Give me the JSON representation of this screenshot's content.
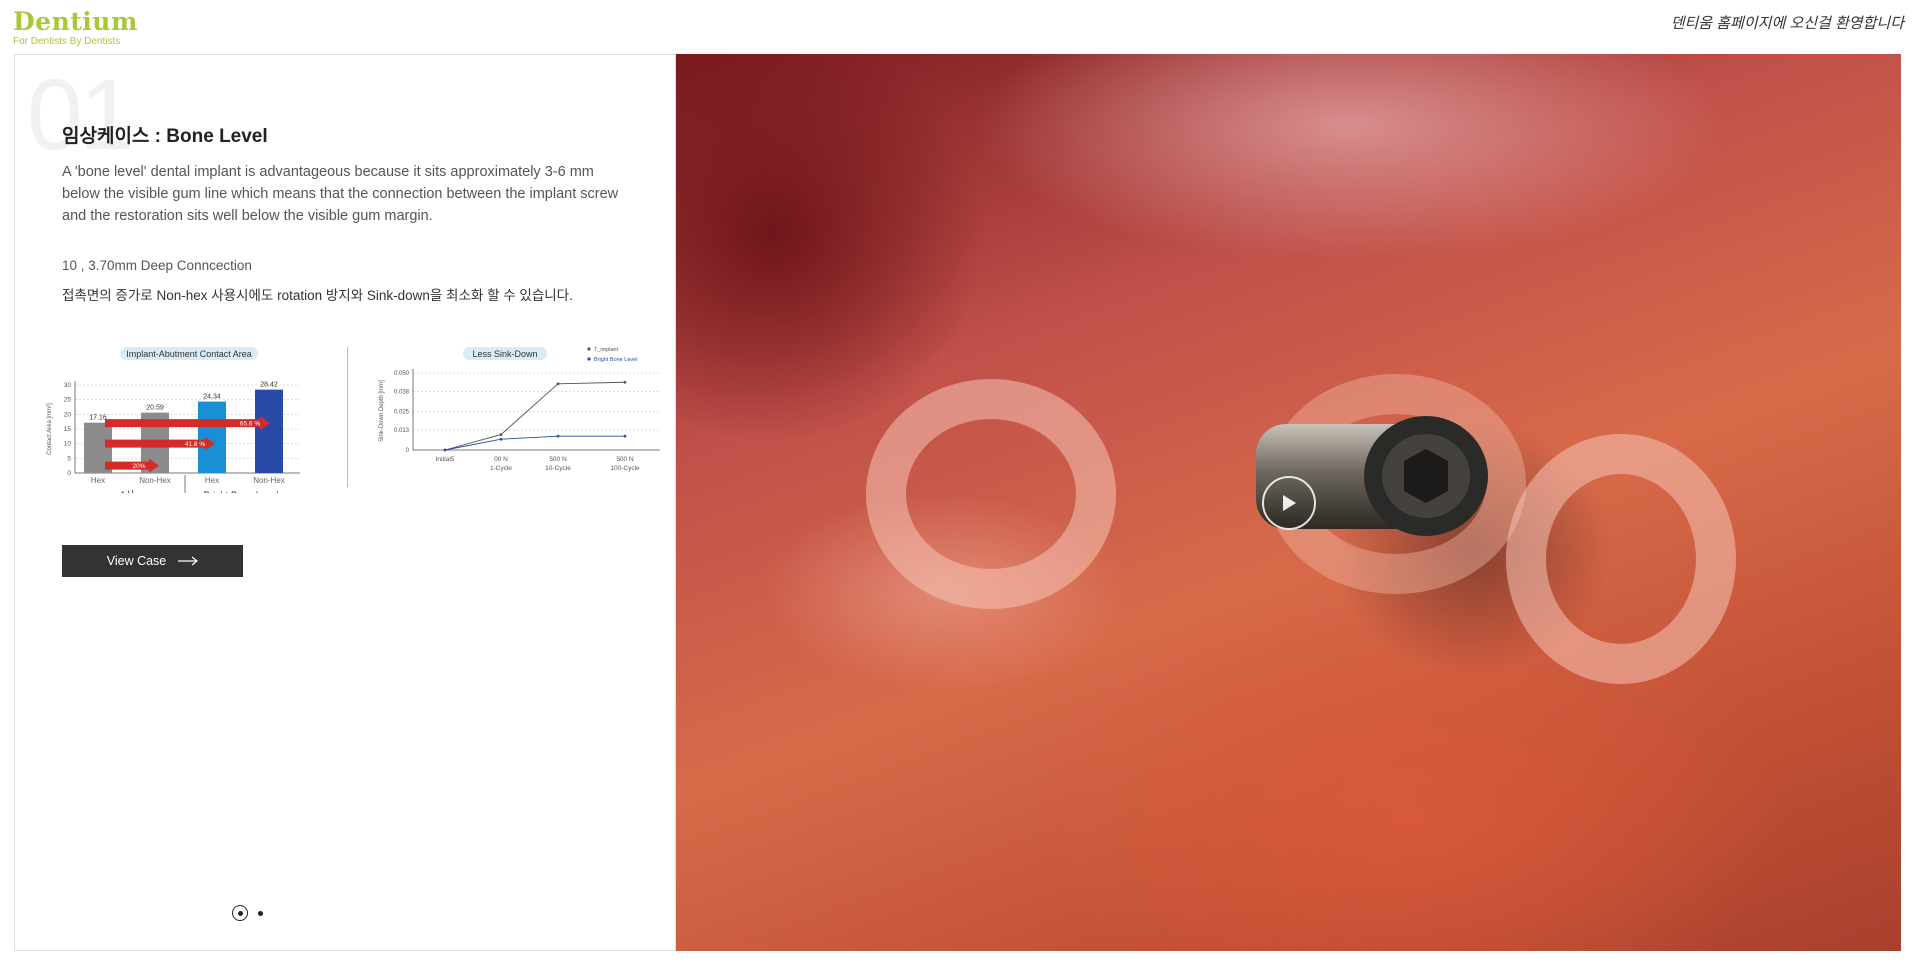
{
  "header": {
    "logo_name": "Dentium",
    "logo_tagline": "For Dentists By Dentists",
    "welcome_text": "덴티움 홈페이지에 오신걸 환영합니다"
  },
  "slide": {
    "number": "01",
    "title": "임상케이스 : Bone Level",
    "description": "A 'bone level' dental implant is advantageous because it sits approximately 3-6 mm below the visible gum line which means that the connection between the implant screw and the restoration sits well below the visible gum margin.",
    "spec": "10 , 3.70mm Deep Conncection",
    "spec_description": "접촉면의 증가로 Non-hex 사용시에도 rotation 방지와 Sink-down을 최소화 할 수 있습니다.",
    "view_button_label": "View Case"
  },
  "chart_data": [
    {
      "type": "bar",
      "title": "Implant-Abutment Contact Area",
      "ylabel": "Contact Area [mm²]",
      "ylim": [
        0,
        30
      ],
      "yticks": [
        "0",
        "5",
        "10",
        "15",
        "20",
        "25",
        "30"
      ],
      "categories": [
        "Hex",
        "Non-Hex",
        "Hex",
        "Non-Hex"
      ],
      "groups": [
        "A사",
        "Bright Bone Level"
      ],
      "values": [
        17.16,
        20.59,
        24.34,
        28.42
      ],
      "value_labels": [
        "17.16",
        "20.59",
        "24.34",
        "28.42"
      ],
      "colors": [
        "#8c8c8c",
        "#8c8c8c",
        "#1a8fd6",
        "#2a4aa8"
      ],
      "annotations": [
        "20%",
        "41.8 %",
        "65.6 %"
      ]
    },
    {
      "type": "line",
      "title": "Less Sink-Down",
      "ylabel": "Sink-Down Depth [mm]",
      "ylim": [
        0,
        0.05
      ],
      "yticks": [
        "0",
        "0.013",
        "0.025",
        "0.038",
        "0.050"
      ],
      "categories": [
        "Initial5",
        "00 N 1-Cycle",
        "500 N 10-Cycle",
        "500 N 100-Cycle"
      ],
      "x_labels": [
        [
          "Initial5",
          ""
        ],
        [
          "00 N",
          "1-Cycle"
        ],
        [
          "500 N",
          "10-Cycle"
        ],
        [
          "500 N",
          "100-Cycle"
        ]
      ],
      "series": [
        {
          "name": "T_implant",
          "values": [
            0,
            0.01,
            0.043,
            0.044
          ],
          "color": "#555555"
        },
        {
          "name": "Bright Bone Level",
          "values": [
            0,
            0.007,
            0.009,
            0.009
          ],
          "color": "#2a4aa8"
        }
      ]
    }
  ],
  "pagination": {
    "total": 2,
    "active": 0
  }
}
